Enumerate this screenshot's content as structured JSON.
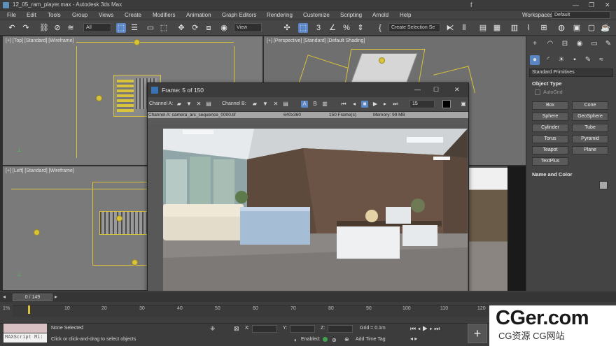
{
  "window": {
    "title": "12_05_ram_player.max - Autodesk 3ds Max",
    "right_glyph": "f"
  },
  "menu": [
    "File",
    "Edit",
    "Tools",
    "Group",
    "Views",
    "Create",
    "Modifiers",
    "Animation",
    "Graph Editors",
    "Rendering",
    "Customize",
    "Scripting",
    "Arnold",
    "Help"
  ],
  "workspaces": {
    "label": "Workspaces:",
    "value": "Default"
  },
  "toolbar": {
    "filter": "All",
    "refcoord": "View",
    "selection_set": "Create Selection Se"
  },
  "viewports": {
    "top": "[+] [Top] [Standard] [Wireframe]",
    "perspective": "[+] [Perspective] [Standard] [Default Shading]",
    "left": "[+] [Left] [Standard] [Wireframe]"
  },
  "command_panel": {
    "category": "Standard Primitives",
    "object_type": "Object Type",
    "autogrid": "AutoGrid",
    "buttons": [
      "Box",
      "Cone",
      "Sphere",
      "GeoSphere",
      "Cylinder",
      "Tube",
      "Torus",
      "Pyramid",
      "Teapot",
      "Plane",
      "TextPlus"
    ],
    "name_and_color": "Name and Color"
  },
  "ram_player": {
    "title": "Frame: 5 of 150",
    "channel_a_label": "Channel A:",
    "channel_b_label": "Channel B:",
    "a_btn": "A",
    "b_btn": "B",
    "frame_rate": "15",
    "info": {
      "channel": "Channel A: camera_arc_sequence_0000.tif",
      "resolution": "640x360",
      "frames": "150 Frame(s)",
      "memory": "Memory: 99 MB"
    }
  },
  "timeline": {
    "slider": "0 / 149",
    "ticks": [
      "10",
      "20",
      "30",
      "40",
      "50",
      "60",
      "70",
      "80",
      "90",
      "100",
      "110",
      "120"
    ]
  },
  "status": {
    "selection": "None Selected",
    "prompt": "Click or click-and-drag to select objects",
    "maxscript": "MAXScript Mi:",
    "x_label": "X:",
    "y_label": "Y:",
    "z_label": "Z:",
    "grid": "Grid = 0.1m",
    "enabled": "Enabled:",
    "add_time_tag": "Add Time Tag"
  },
  "watermark": {
    "line1": "CGer.com",
    "line2": "CG资源 CG网站"
  }
}
